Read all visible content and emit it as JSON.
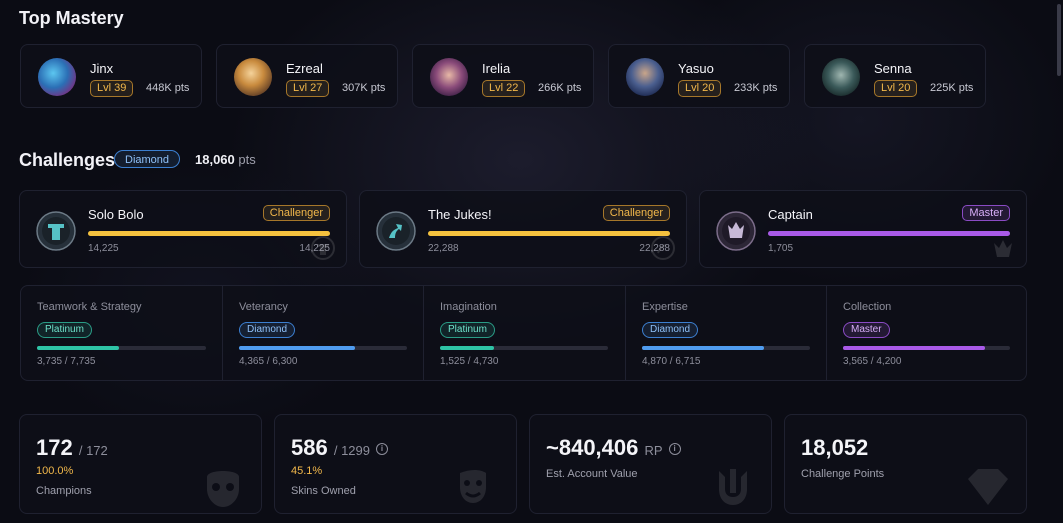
{
  "mastery": {
    "title": "Top Mastery",
    "champions": [
      {
        "name": "Jinx",
        "level": "Lvl 39",
        "points": "448K pts"
      },
      {
        "name": "Ezreal",
        "level": "Lvl 27",
        "points": "307K pts"
      },
      {
        "name": "Irelia",
        "level": "Lvl 22",
        "points": "266K pts"
      },
      {
        "name": "Yasuo",
        "level": "Lvl 20",
        "points": "233K pts"
      },
      {
        "name": "Senna",
        "level": "Lvl 20",
        "points": "225K pts"
      }
    ]
  },
  "challenges": {
    "title": "Challenges",
    "tier": "Diamond",
    "points_value": "18,060",
    "points_unit": "pts",
    "featured": [
      {
        "name": "Solo Bolo",
        "tier": "Challenger",
        "current": "14,225",
        "threshold": "14,225",
        "progress": 1.0,
        "color": "#f5c23e"
      },
      {
        "name": "The Jukes!",
        "tier": "Challenger",
        "current": "22,288",
        "threshold": "22,288",
        "progress": 1.0,
        "color": "#f5c23e"
      },
      {
        "name": "Captain",
        "tier": "Master",
        "current": "1,705",
        "threshold": "",
        "progress": 1.0,
        "color": "#a95ae8"
      }
    ],
    "categories": [
      {
        "name": "Teamwork & Strategy",
        "tier": "Platinum",
        "progress_text": "3,735 / 7,735",
        "progress": 0.483,
        "color": "#2ec4a6"
      },
      {
        "name": "Veterancy",
        "tier": "Diamond",
        "progress_text": "4,365 / 6,300",
        "progress": 0.693,
        "color": "#4f9cf0"
      },
      {
        "name": "Imagination",
        "tier": "Platinum",
        "progress_text": "1,525 / 4,730",
        "progress": 0.322,
        "color": "#2ec4a6"
      },
      {
        "name": "Expertise",
        "tier": "Diamond",
        "progress_text": "4,870 / 6,715",
        "progress": 0.725,
        "color": "#4f9cf0"
      },
      {
        "name": "Collection",
        "tier": "Master",
        "progress_text": "3,565 / 4,200",
        "progress": 0.849,
        "color": "#a95ae8"
      }
    ]
  },
  "stats": [
    {
      "value": "172",
      "sub": "/ 172",
      "percent": "100.0%",
      "label": "Champions",
      "icon": "mask-icon"
    },
    {
      "value": "586",
      "sub": "/ 1299",
      "percent": "45.1%",
      "label": "Skins Owned",
      "icon": "theater-masks-icon"
    },
    {
      "value": "~840,406",
      "sub": "RP",
      "percent": "",
      "label": "Est. Account Value",
      "icon": "trident-icon"
    },
    {
      "value": "18,052",
      "sub": "",
      "percent": "",
      "label": "Challenge Points",
      "icon": "gem-icon"
    }
  ]
}
